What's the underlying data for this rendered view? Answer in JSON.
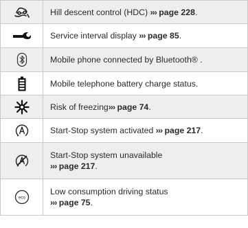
{
  "rows": [
    {
      "icon": "hill-descent-control-icon",
      "text": "Hill descent control (HDC)",
      "arrows": "›››",
      "ref": "page 228",
      "after": ".",
      "ref_newline": false
    },
    {
      "icon": "wrench-icon",
      "text": "Service interval display",
      "arrows": "›››",
      "ref": "page 85",
      "after": ".",
      "ref_newline": false
    },
    {
      "icon": "bluetooth-icon",
      "text": "Mobile phone connected by Bluetooth® .",
      "arrows": "",
      "ref": "",
      "after": "",
      "ref_newline": false
    },
    {
      "icon": "battery-icon",
      "text": "Mobile telephone battery charge status.",
      "arrows": "",
      "ref": "",
      "after": "",
      "ref_newline": false
    },
    {
      "icon": "snowflake-icon",
      "text": "Risk of freezing",
      "arrows": "›››",
      "ref": "page 74",
      "after": ".",
      "ref_newline": false
    },
    {
      "icon": "start-stop-active-icon",
      "text": "Start-Stop system activated",
      "arrows": "›››",
      "ref": "page 217",
      "after": ".",
      "ref_newline": false
    },
    {
      "icon": "start-stop-unavailable-icon",
      "text": "Start-Stop system unavailable",
      "arrows": "›››",
      "ref": "page 217",
      "after": ".",
      "ref_newline": true
    },
    {
      "icon": "eco-icon",
      "text": "Low consumption driving status",
      "arrows": "›››",
      "ref": "page 75",
      "after": ".",
      "ref_newline": true
    }
  ]
}
